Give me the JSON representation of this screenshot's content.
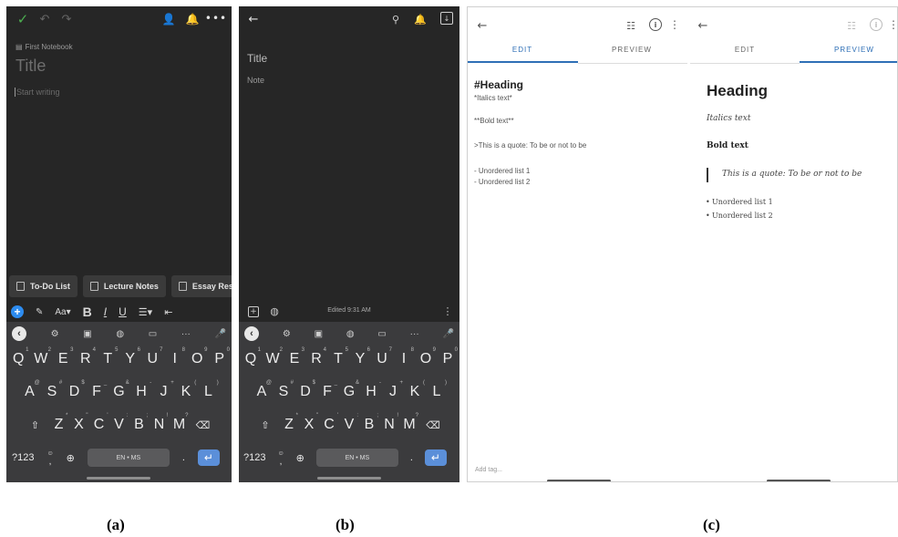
{
  "panel_a": {
    "notebook": "First Notebook",
    "title_placeholder": "Title",
    "body_placeholder": "Start writing",
    "templates": [
      "To-Do List",
      "Lecture Notes",
      "Essay Rese"
    ],
    "format_bar": {
      "font_size": "Aa",
      "bold": "B",
      "italic": "I",
      "underline": "U"
    },
    "caption": "(a)"
  },
  "panel_b": {
    "title_placeholder": "Title",
    "note_placeholder": "Note",
    "edited": "Edited 9:31 AM",
    "caption": "(b)"
  },
  "keyboard": {
    "row1": [
      "Q",
      "W",
      "E",
      "R",
      "T",
      "Y",
      "U",
      "I",
      "O",
      "P"
    ],
    "row1_hints": [
      "1",
      "2",
      "3",
      "4",
      "5",
      "6",
      "7",
      "8",
      "9",
      "0"
    ],
    "row2": [
      "A",
      "S",
      "D",
      "F",
      "G",
      "H",
      "J",
      "K",
      "L"
    ],
    "row2_hints": [
      "@",
      "#",
      "$",
      "_",
      "&",
      "-",
      "+",
      "(",
      ")"
    ],
    "row3": [
      "Z",
      "X",
      "C",
      "V",
      "B",
      "N",
      "M"
    ],
    "row3_hints": [
      "*",
      "\"",
      "'",
      ":",
      ";",
      "!",
      "?"
    ],
    "numbers_key": "?123",
    "comma_hint": "☺",
    "comma": ",",
    "space": "EN • MS",
    "period": "."
  },
  "panel_c": {
    "edit_tab": "EDIT",
    "preview_tab": "PREVIEW",
    "markdown": {
      "heading": "#Heading",
      "italics": "*Italics text*",
      "bold": "**Bold text**",
      "quote": ">This is a quote: To be or not to be",
      "list1": "- Unordered list 1",
      "list2": "- Unordered list 2"
    },
    "preview": {
      "heading": "Heading",
      "italics": "Italics text",
      "bold": "Bold text",
      "quote": "This is a quote: To be or not to be",
      "list1": "Unordered list 1",
      "list2": "Unordered list 2"
    },
    "add_tag_placeholder": "Add tag...",
    "caption": "(c)"
  },
  "colors": {
    "dark_bg": "#262626",
    "keyboard_bg": "#3b3b3d",
    "accent_blue": "#2e6fb6",
    "check_green": "#4caf50"
  }
}
